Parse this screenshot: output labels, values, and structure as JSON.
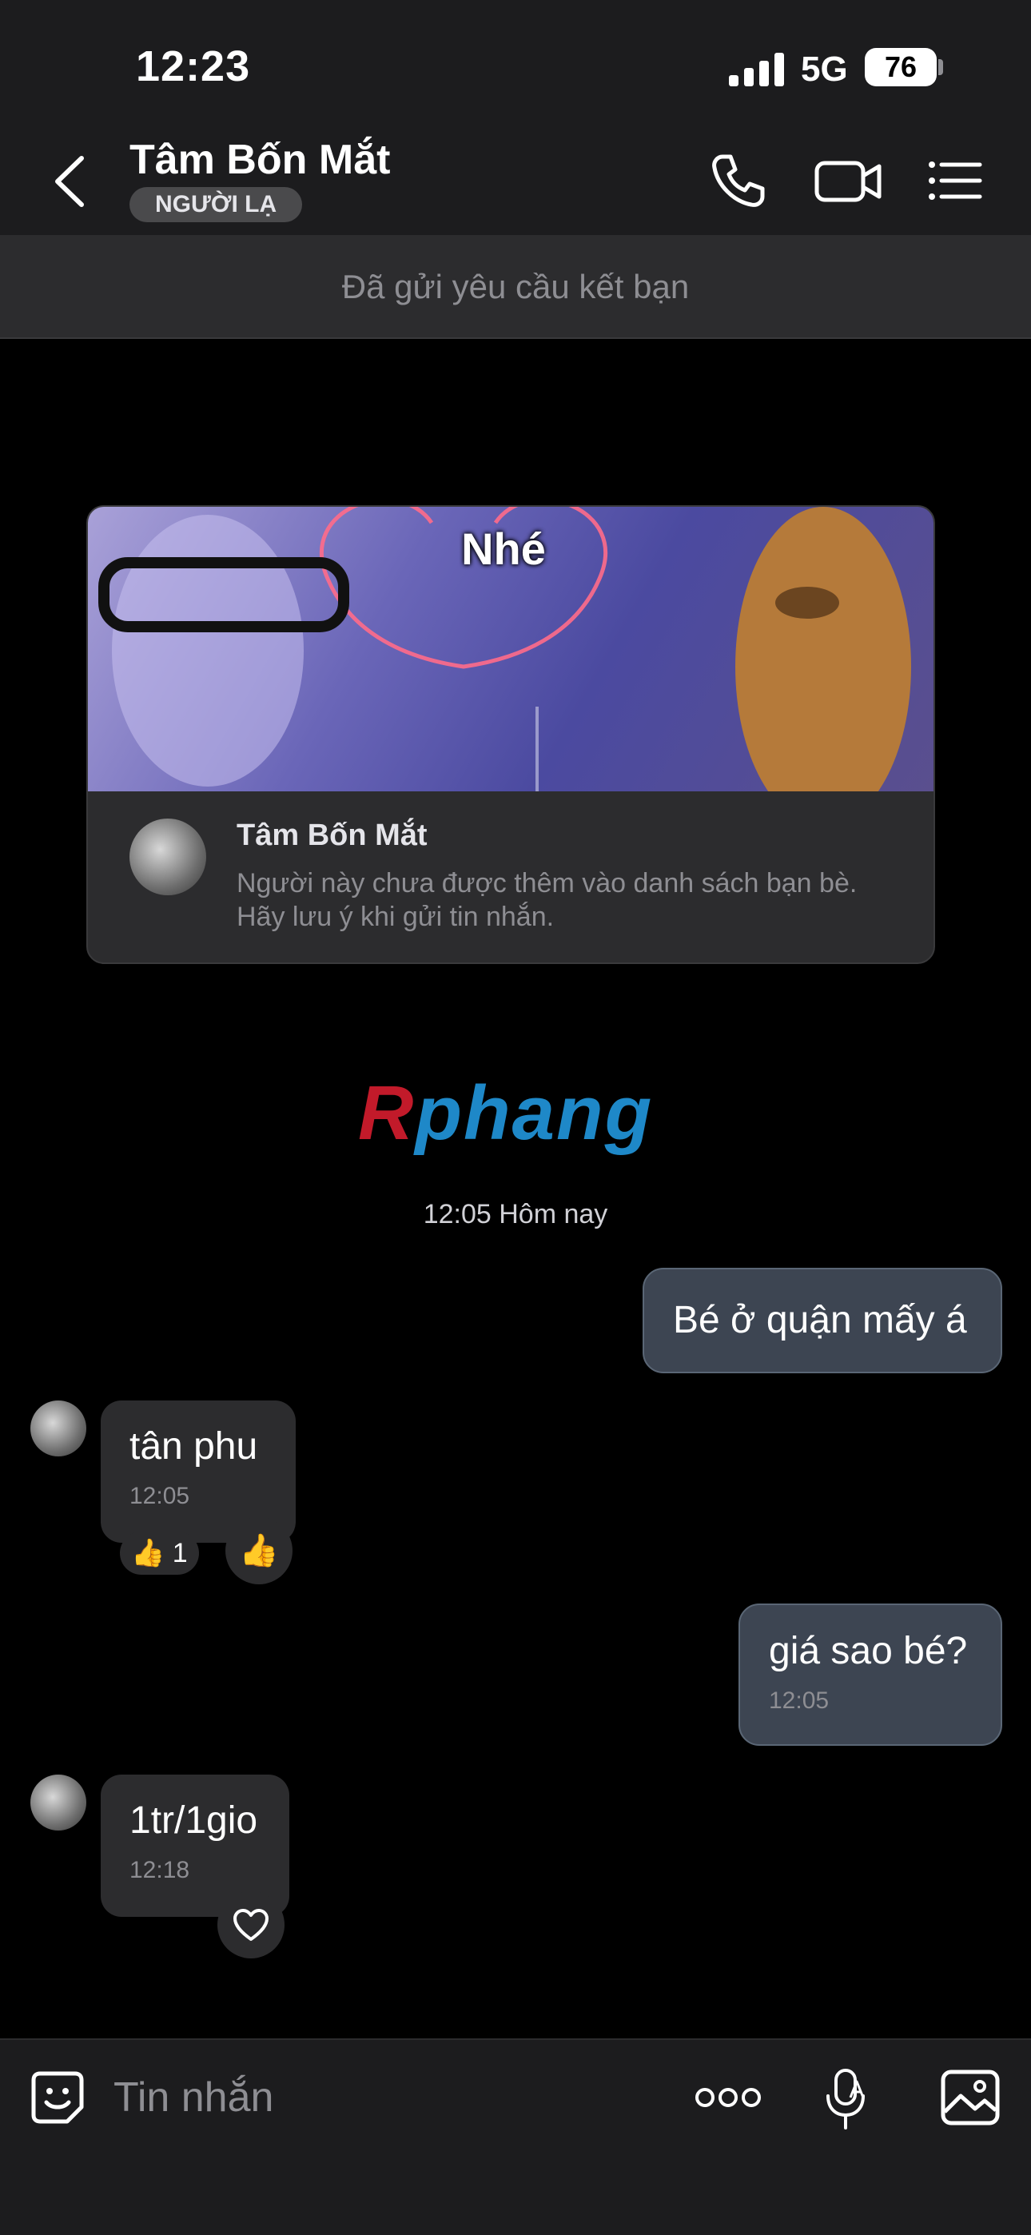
{
  "status_bar": {
    "time": "12:23",
    "network": "5G",
    "battery": "76"
  },
  "header": {
    "contact_name": "Tâm Bốn Mắt",
    "badge": "NGƯỜI LẠ"
  },
  "friend_request_banner": "Đã gửi yêu cầu kết bạn",
  "profile_card": {
    "cover_caption": "Nhé",
    "name": "Tâm Bốn Mắt",
    "note": "Người này chưa được thêm vào danh sách bạn bè. Hãy lưu ý khi gửi tin nhắn."
  },
  "watermark": {
    "first": "R",
    "rest": "phang"
  },
  "timestamp_separator": "12:05 Hôm nay",
  "messages": [
    {
      "direction": "sent",
      "text": "Bé ở quận mấy á",
      "time": ""
    },
    {
      "direction": "received",
      "text": "tân phu",
      "time": "12:05",
      "reaction_emoji": "👍",
      "reaction_count": "1"
    },
    {
      "direction": "sent",
      "text": "giá sao bé?",
      "time": "12:05"
    },
    {
      "direction": "received",
      "text": "1tr/1gio",
      "time": "12:18"
    }
  ],
  "input": {
    "placeholder": "Tin nhắn"
  },
  "icons": {
    "back": "chevron-left-icon",
    "call": "phone-icon",
    "video": "video-camera-icon",
    "menu": "list-menu-icon",
    "emoji": "sticker-face-icon",
    "more": "more-dots-icon",
    "mic": "mic-icon",
    "image": "image-icon",
    "react": "heart-icon"
  },
  "colors": {
    "sent_bubble": "#3d4552",
    "received_bubble": "#2c2c2e",
    "background": "#000000"
  }
}
